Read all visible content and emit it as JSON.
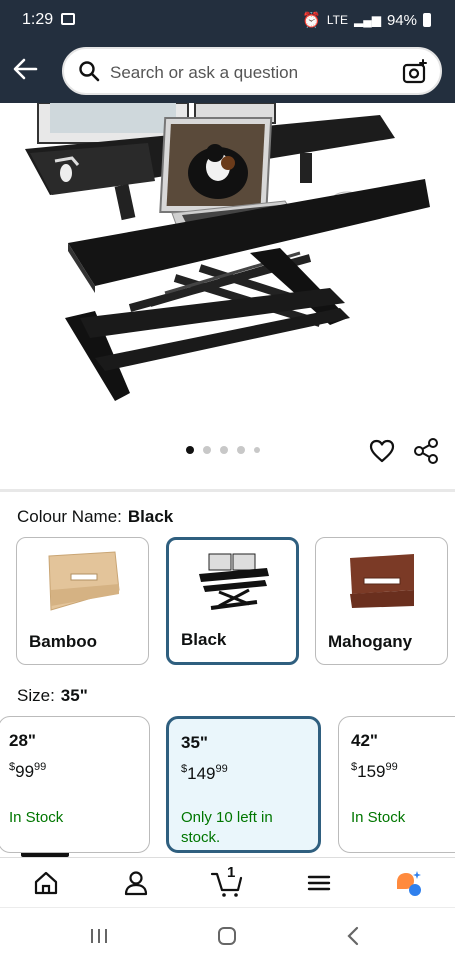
{
  "status_bar": {
    "time": "1:29",
    "network": "LTE",
    "battery": "94%"
  },
  "search": {
    "placeholder": "Search or ask a question"
  },
  "gallery": {
    "dot_count": 5,
    "active_index": 0
  },
  "colour": {
    "label": "Colour Name:",
    "selected": "Black",
    "options": [
      {
        "name": "Bamboo"
      },
      {
        "name": "Black"
      },
      {
        "name": "Mahogany"
      }
    ]
  },
  "size": {
    "label": "Size:",
    "selected": "35\"",
    "options": [
      {
        "size": "28\"",
        "currency": "$",
        "whole": "99",
        "fraction": "99",
        "stock": "In Stock"
      },
      {
        "size": "35\"",
        "currency": "$",
        "whole": "149",
        "fraction": "99",
        "stock": "Only 10 left in stock."
      },
      {
        "size": "42\"",
        "currency": "$",
        "whole": "159",
        "fraction": "99",
        "stock": "In Stock"
      }
    ]
  },
  "cart": {
    "count": "1"
  },
  "colors": {
    "header_bg": "#232f3e",
    "selected_border": "#2f5f7f",
    "selected_bg": "#eaf6fb",
    "stock_green": "#007600",
    "assistant_orange": "#ff8a3d",
    "assistant_blue": "#2f80ed"
  }
}
